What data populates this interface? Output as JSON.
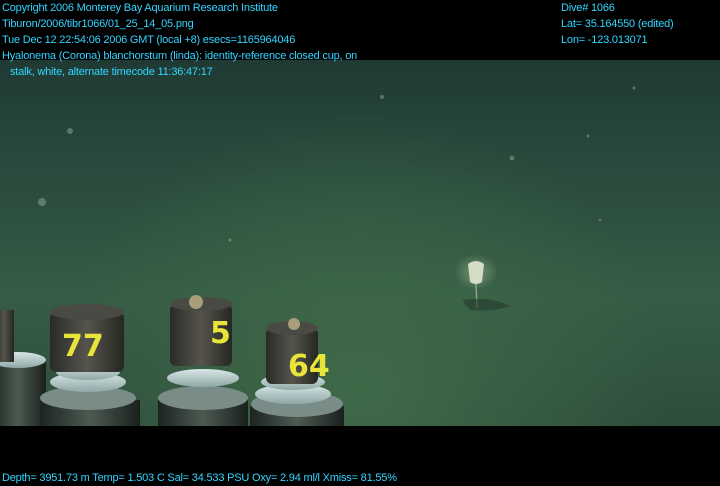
{
  "header_left": {
    "copyright": "Copyright 2006 Monterey Bay Aquarium Research Institute",
    "file": "Tiburon/2006/tibr1066/01_25_14_05.png",
    "timestamp": "Tue Dec 12 22:54:06 2006 GMT (local +8)  esecs=1165964046",
    "annotation_line1": "Hyalonema (Corona) blanchorstum (linda): identity-reference closed cup, on",
    "annotation_line2": "stalk, white, alternate timecode 11:36:47:17"
  },
  "header_right": {
    "dive": "Dive# 1066",
    "lat": "Lat= 35.164550 (edited)",
    "lon": "Lon= -123.013071"
  },
  "footer": {
    "telemetry": "Depth= 3951.73 m  Temp= 1.503 C  Sal= 34.533 PSU  Oxy= 2.94 ml/l  Xmiss= 81.55%"
  },
  "tube_labels": [
    "77",
    "5",
    "64"
  ]
}
